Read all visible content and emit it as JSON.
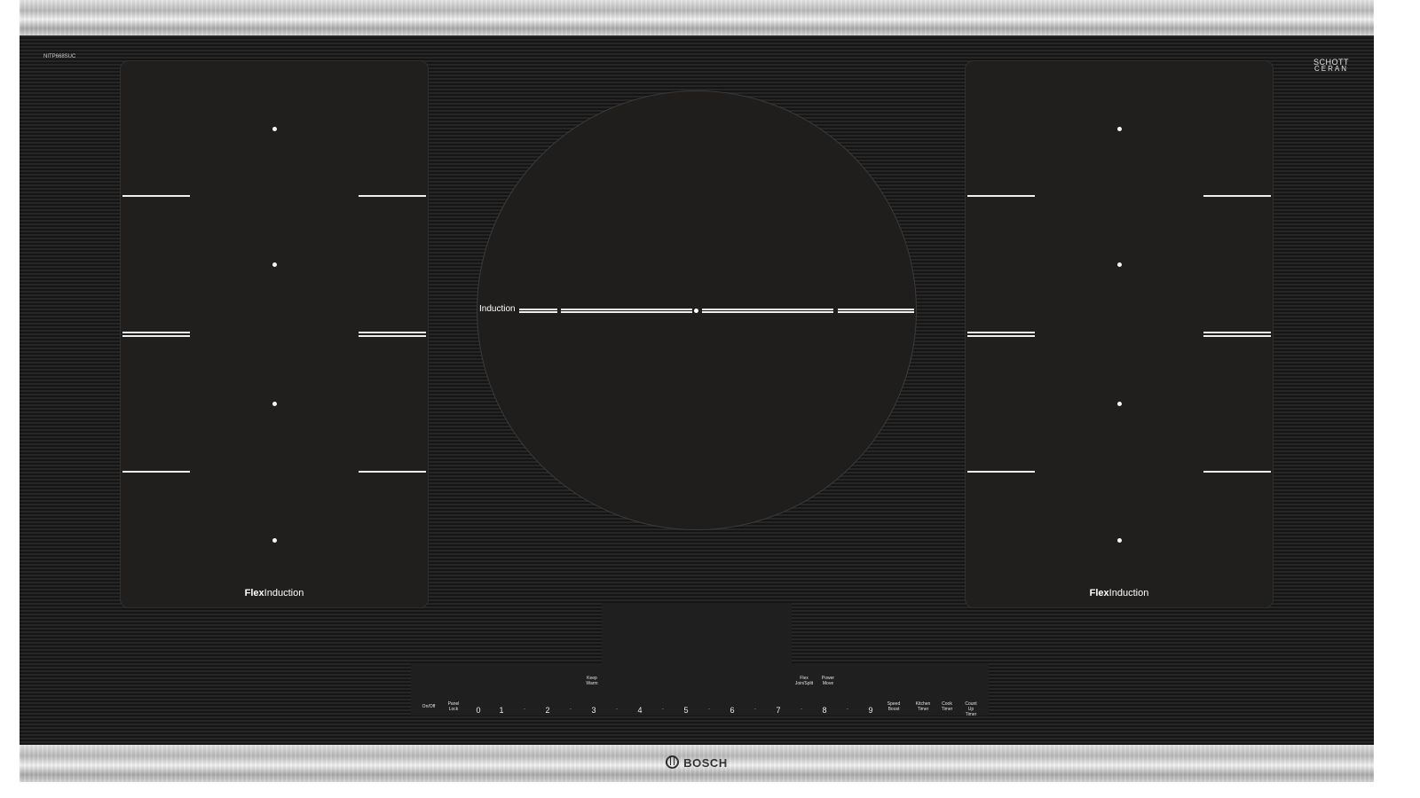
{
  "product": {
    "model_number": "NITP668SUC",
    "glass_brand_line1": "SCHOTT",
    "glass_brand_line2": "CERAN",
    "brand": "BOSCH"
  },
  "zones": {
    "left_label_bold": "Flex",
    "left_label_rest": "Induction",
    "right_label_bold": "Flex",
    "right_label_rest": "Induction",
    "center_label": "Induction"
  },
  "controls": {
    "on_off": "On/Off",
    "panel_lock_1": "Panel",
    "panel_lock_2": "Lock",
    "keep_warm_1": "Keep",
    "keep_warm_2": "Warm",
    "flex_1": "Flex",
    "flex_2": "Join/Split",
    "power_move_1": "Power",
    "power_move_2": "Move",
    "speed_boost_1": "Speed",
    "speed_boost_2": "Boost",
    "kitchen_timer_1": "Kitchen",
    "kitchen_timer_2": "Timer",
    "cook_timer_1": "Cook",
    "cook_timer_2": "Timer",
    "count_up_1": "Count Up",
    "count_up_2": "Timer",
    "levels": [
      "0",
      "1",
      "2",
      "3",
      "4",
      "5",
      "6",
      "7",
      "8",
      "9"
    ],
    "half_step": "·"
  },
  "colors": {
    "glass": "#1b1b1b",
    "trim": "#c9c9c9",
    "markings": "#f0f0f0"
  }
}
